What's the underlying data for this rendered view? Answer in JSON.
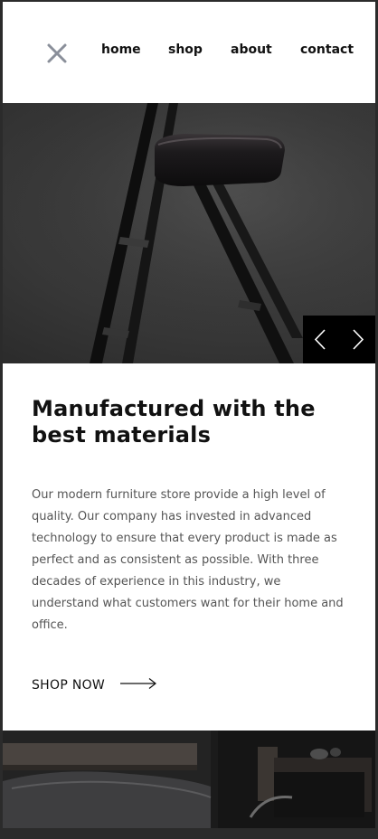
{
  "nav": {
    "close_icon": "close-icon",
    "links": [
      "home",
      "shop",
      "about",
      "contact"
    ]
  },
  "hero": {
    "image": "dark chair photo",
    "prev_icon": "chevron-left-icon",
    "next_icon": "chevron-right-icon"
  },
  "content": {
    "headline": "Manufactured with the best materials",
    "body": "Our modern furniture store provide a high level of quality. Our company has invested in advanced technology to ensure that every product is made as perfect and as consistent as possible. With three decades of experience in this industry, we understand what customers want for their home and office.",
    "cta_label": "SHOP NOW",
    "cta_icon": "arrow-right-icon"
  },
  "bottom_image": "dark bedroom photo",
  "colors": {
    "background": "#2b2b2b",
    "text": "#111111",
    "body_text": "#555555",
    "close_icon": "#8a8f9a",
    "slider_controls": "#000000"
  }
}
